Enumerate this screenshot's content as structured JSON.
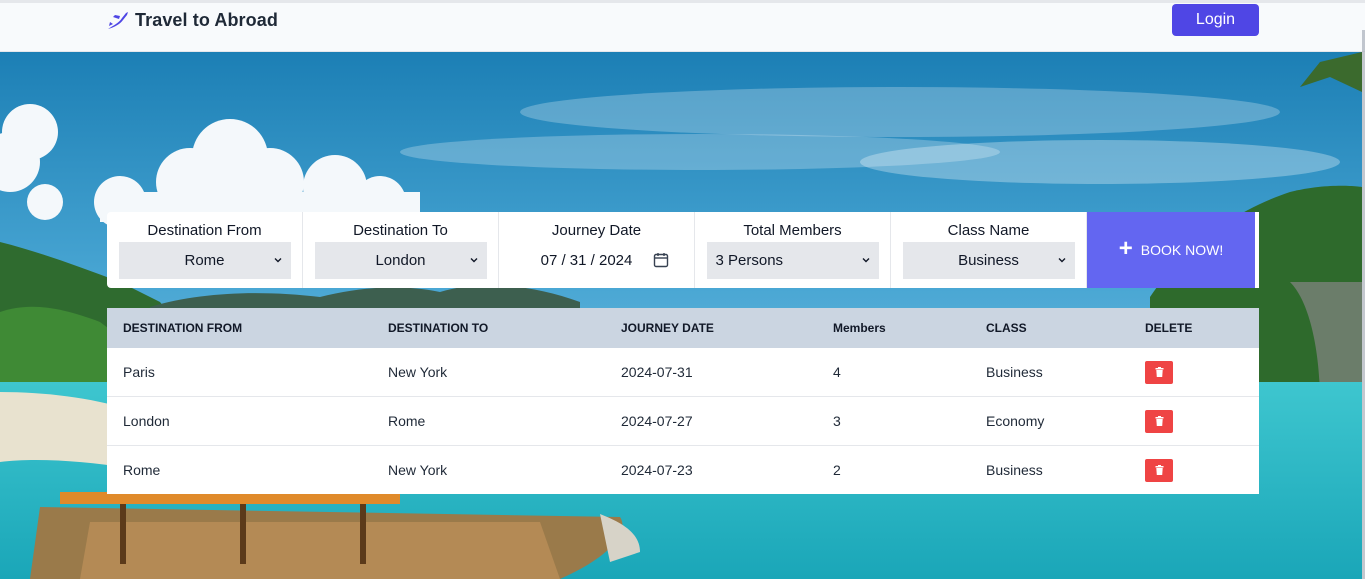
{
  "brand": {
    "name": "Travel to Abroad",
    "logo_icon": "plane-icon",
    "color": "#4f46e5"
  },
  "nav": {
    "login_label": "Login"
  },
  "colors": {
    "accent": "#4f46e5",
    "book": "#6366f1",
    "delete": "#ef4444",
    "table_header": "#cbd5e1"
  },
  "booking": {
    "from": {
      "label": "Destination From",
      "value": "Rome"
    },
    "to": {
      "label": "Destination To",
      "value": "London"
    },
    "date": {
      "label": "Journey Date",
      "value": "07 / 31 / 2024"
    },
    "members": {
      "label": "Total Members",
      "value": "3 Persons"
    },
    "class": {
      "label": "Class Name",
      "value": "Business"
    },
    "book_label": "BOOK NOW!"
  },
  "table": {
    "headers": [
      "DESTINATION FROM",
      "DESTINATION TO",
      "JOURNEY DATE",
      "Members",
      "CLASS",
      "DELETE"
    ],
    "rows": [
      [
        "Paris",
        "New York",
        "2024-07-31",
        "4",
        "Business"
      ],
      [
        "London",
        "Rome",
        "2024-07-27",
        "3",
        "Economy"
      ],
      [
        "Rome",
        "New York",
        "2024-07-23",
        "2",
        "Business"
      ]
    ]
  }
}
